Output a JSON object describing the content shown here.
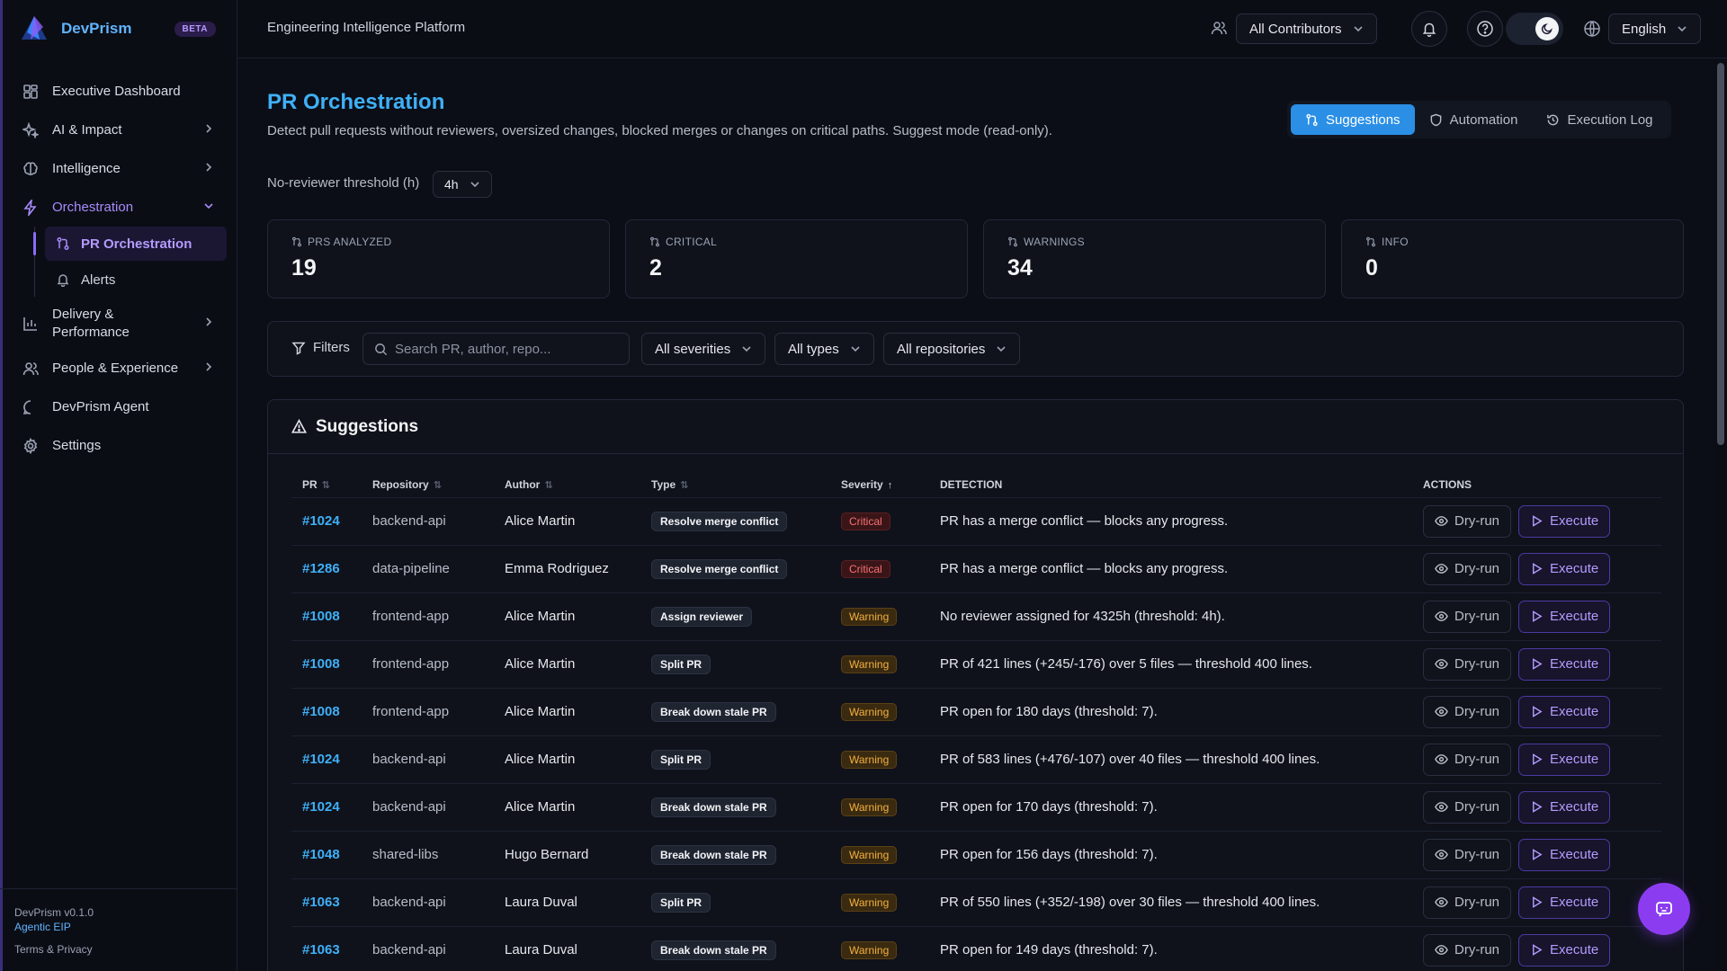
{
  "brand": {
    "name": "DevPrism",
    "badge": "BETA"
  },
  "sidebar": {
    "items": [
      {
        "label": "Executive Dashboard",
        "icon": "dashboard-icon"
      },
      {
        "label": "AI & Impact",
        "icon": "sparkles-icon"
      },
      {
        "label": "Intelligence",
        "icon": "brain-icon"
      },
      {
        "label": "Orchestration",
        "icon": "zap-icon",
        "active": true
      },
      {
        "label": "Delivery & Performance",
        "icon": "bar-chart-icon"
      },
      {
        "label": "People & Experience",
        "icon": "users-icon"
      },
      {
        "label": "DevPrism Agent",
        "icon": "chat-icon"
      },
      {
        "label": "Settings",
        "icon": "gear-icon"
      }
    ],
    "sub": [
      {
        "label": "PR Orchestration",
        "icon": "git-pull-request-icon",
        "active": true
      },
      {
        "label": "Alerts",
        "icon": "bell-icon"
      }
    ],
    "footer": {
      "version": "DevPrism v0.1.0",
      "edition": "Agentic EIP",
      "terms": "Terms & Privacy"
    }
  },
  "header": {
    "title": "Engineering Intelligence Platform",
    "contributors": "All Contributors",
    "language": "English"
  },
  "page": {
    "title": "PR Orchestration",
    "description": "Detect pull requests without reviewers, oversized changes, blocked merges or changes on critical paths. Suggest mode (read-only).",
    "tabs": [
      "Suggestions",
      "Automation",
      "Execution Log"
    ],
    "threshold_label": "No-reviewer threshold (h)",
    "threshold_value": "4h"
  },
  "stats": [
    {
      "label": "PRS ANALYZED",
      "value": "19"
    },
    {
      "label": "CRITICAL",
      "value": "2"
    },
    {
      "label": "WARNINGS",
      "value": "34"
    },
    {
      "label": "INFO",
      "value": "0"
    }
  ],
  "filters": {
    "label": "Filters",
    "search_placeholder": "Search PR, author, repo...",
    "severity": "All severities",
    "type": "All types",
    "repository": "All repositories"
  },
  "suggestions": {
    "title": "Suggestions",
    "columns": [
      "PR",
      "Repository",
      "Author",
      "Type",
      "Severity",
      "DETECTION",
      "ACTIONS"
    ],
    "dry_run_label": "Dry-run",
    "execute_label": "Execute",
    "rows": [
      {
        "pr": "#1024",
        "repo": "backend-api",
        "author": "Alice Martin",
        "type": "Resolve merge conflict",
        "severity": "Critical",
        "detection": "PR has a merge conflict — blocks any progress."
      },
      {
        "pr": "#1286",
        "repo": "data-pipeline",
        "author": "Emma Rodriguez",
        "type": "Resolve merge conflict",
        "severity": "Critical",
        "detection": "PR has a merge conflict — blocks any progress."
      },
      {
        "pr": "#1008",
        "repo": "frontend-app",
        "author": "Alice Martin",
        "type": "Assign reviewer",
        "severity": "Warning",
        "detection": "No reviewer assigned for 4325h (threshold: 4h)."
      },
      {
        "pr": "#1008",
        "repo": "frontend-app",
        "author": "Alice Martin",
        "type": "Split PR",
        "severity": "Warning",
        "detection": "PR of 421 lines (+245/-176) over 5 files — threshold 400 lines."
      },
      {
        "pr": "#1008",
        "repo": "frontend-app",
        "author": "Alice Martin",
        "type": "Break down stale PR",
        "severity": "Warning",
        "detection": "PR open for 180 days (threshold: 7)."
      },
      {
        "pr": "#1024",
        "repo": "backend-api",
        "author": "Alice Martin",
        "type": "Split PR",
        "severity": "Warning",
        "detection": "PR of 583 lines (+476/-107) over 40 files — threshold 400 lines."
      },
      {
        "pr": "#1024",
        "repo": "backend-api",
        "author": "Alice Martin",
        "type": "Break down stale PR",
        "severity": "Warning",
        "detection": "PR open for 170 days (threshold: 7)."
      },
      {
        "pr": "#1048",
        "repo": "shared-libs",
        "author": "Hugo Bernard",
        "type": "Break down stale PR",
        "severity": "Warning",
        "detection": "PR open for 156 days (threshold: 7)."
      },
      {
        "pr": "#1063",
        "repo": "backend-api",
        "author": "Laura Duval",
        "type": "Split PR",
        "severity": "Warning",
        "detection": "PR of 550 lines (+352/-198) over 30 files — threshold 400 lines."
      },
      {
        "pr": "#1063",
        "repo": "backend-api",
        "author": "Laura Duval",
        "type": "Break down stale PR",
        "severity": "Warning",
        "detection": "PR open for 149 days (threshold: 7)."
      }
    ]
  }
}
